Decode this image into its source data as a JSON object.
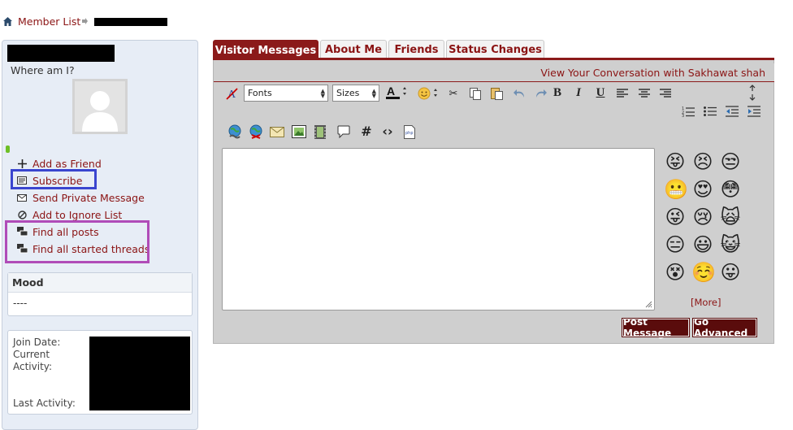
{
  "breadcrumb": {
    "home_icon": "home-icon",
    "link": "Member List"
  },
  "profile": {
    "where_am_i": "Where am I?"
  },
  "actions": {
    "add_friend": "Add as Friend",
    "subscribe": "Subscribe",
    "private_message": "Send Private Message",
    "ignore": "Add to Ignore List",
    "find_posts": "Find all posts",
    "find_threads": "Find all started threads"
  },
  "mood": {
    "title": "Mood",
    "value": "----"
  },
  "info": {
    "join_date": "Join Date:",
    "current_activity": "Current Activity:",
    "last_activity": "Last Activity:"
  },
  "tabs": [
    "Visitor Messages",
    "About Me",
    "Friends",
    "Status Changes"
  ],
  "conversation_link": "View Your Conversation with Sakhawat shah",
  "editor": {
    "fonts_label": "Fonts",
    "sizes_label": "Sizes"
  },
  "smilies": [
    "😝",
    "😣",
    "😒",
    "😬",
    "😍",
    "😳",
    "😜",
    "😢",
    "🙀",
    "😑",
    "😃",
    "😺",
    "😵",
    "☺️",
    "😛"
  ],
  "more_label": "[More]",
  "buttons": {
    "post": "Post Message",
    "advanced": "Go Advanced"
  },
  "colors": {
    "accent": "#8b1a1a",
    "link": "#8b1414",
    "sidebar_bg": "#e7edf6",
    "panel_bg": "#cfcfcf"
  }
}
